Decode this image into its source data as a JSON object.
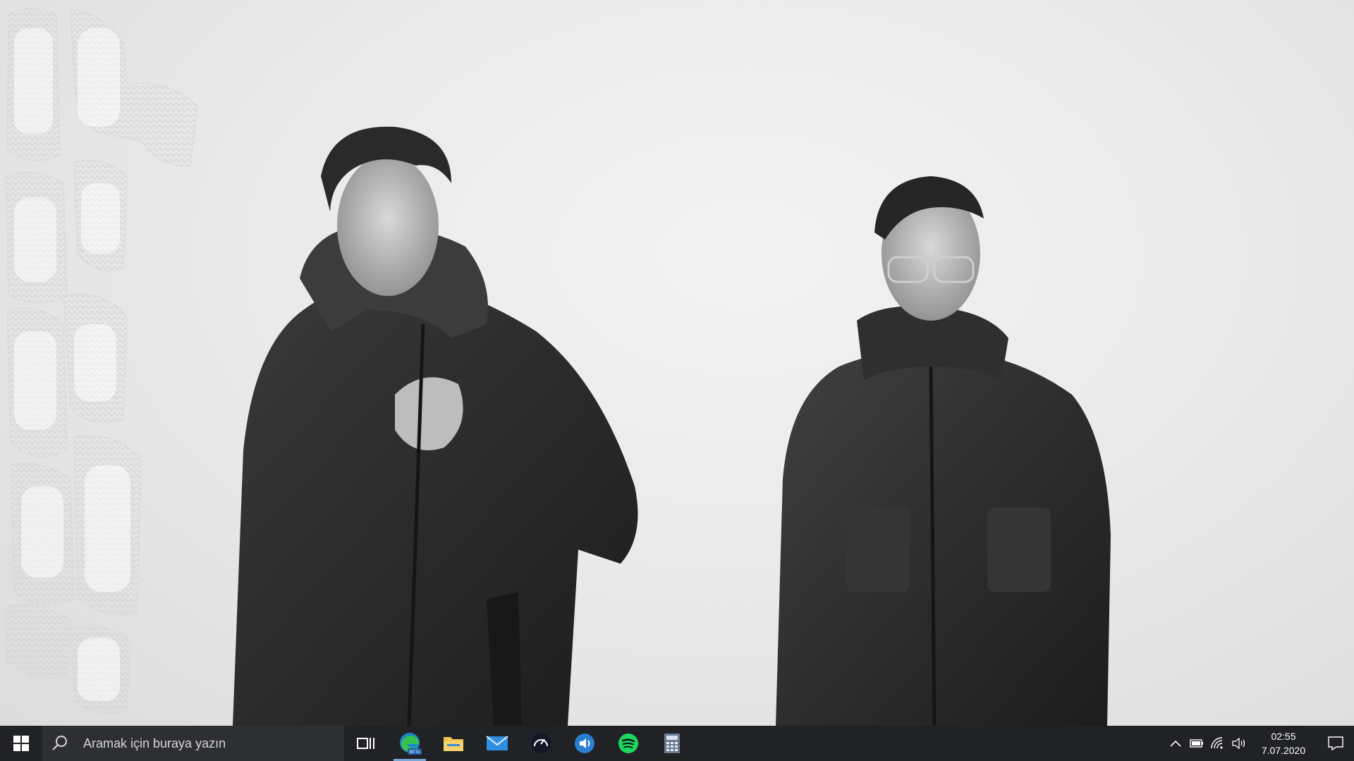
{
  "desktop": {
    "wallpaper": "black-and-white photo of two men in dark hooded jackets against a white wall"
  },
  "taskbar": {
    "search_placeholder": "Aramak için buraya yazın",
    "apps": [
      {
        "name": "Task View",
        "icon": "task-view-icon"
      },
      {
        "name": "Microsoft Edge Beta",
        "icon": "edge-beta-icon",
        "active": true
      },
      {
        "name": "File Explorer",
        "icon": "file-explorer-icon"
      },
      {
        "name": "Mail",
        "icon": "mail-icon"
      },
      {
        "name": "Speedtest",
        "icon": "speedtest-icon"
      },
      {
        "name": "Audio app",
        "icon": "audio-app-icon"
      },
      {
        "name": "Spotify",
        "icon": "spotify-icon"
      },
      {
        "name": "Calculator",
        "icon": "calculator-icon"
      }
    ],
    "clock": {
      "time": "02:55",
      "date": "7.07.2020"
    },
    "colors": {
      "background": "#202226",
      "search_background": "#2d2f33",
      "active_indicator": "#7aa7d8"
    }
  }
}
